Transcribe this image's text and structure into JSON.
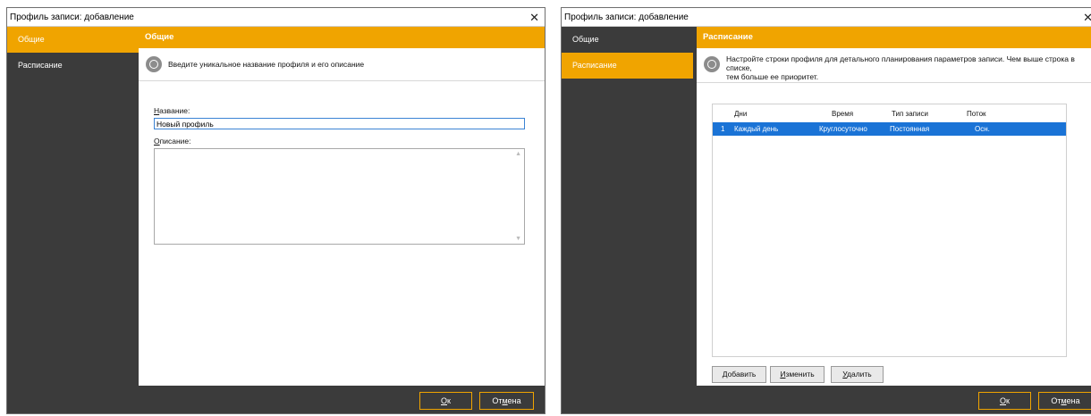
{
  "left_window": {
    "title": "Профиль записи: добавление",
    "sidebar": [
      {
        "label": "Общие",
        "active": true
      },
      {
        "label": "Расписание",
        "active": false
      }
    ],
    "header": "Общие",
    "info_text": "Введите уникальное название профиля и его описание",
    "name_label_ul": "Н",
    "name_label_rest": "азвание:",
    "name_value": "Новый профиль",
    "desc_label_ul": "О",
    "desc_label_rest": "писание:",
    "ok_ul": "О",
    "ok_rest": "к",
    "cancel_pre": "От",
    "cancel_ul": "м",
    "cancel_rest": "ена"
  },
  "right_window": {
    "title": "Профиль записи: добавление",
    "sidebar": [
      {
        "label": "Общие",
        "active": false
      },
      {
        "label": "Расписание",
        "active": true
      }
    ],
    "header": "Расписание",
    "info_line1": "Настройте строки профиля для детального планирования параметров записи. Чем выше строка в списке,",
    "info_line2": "тем больше ее приоритет.",
    "columns": [
      "Дни",
      "Время",
      "Тип записи",
      "Поток"
    ],
    "rows": [
      {
        "num": "1",
        "days": "Каждый день",
        "time": "Круглосуточно",
        "type": "Постоянная",
        "stream": "Осн."
      }
    ],
    "add_ul": "Д",
    "add_rest": "обавить",
    "edit_ul": "И",
    "edit_rest": "зменить",
    "delete_ul": "У",
    "delete_rest": "далить",
    "ok_ul": "О",
    "ok_rest": "к",
    "cancel_pre": "От",
    "cancel_ul": "м",
    "cancel_rest": "ена"
  },
  "colors": {
    "accent": "#f0a400",
    "sidebar": "#3b3b3b",
    "selection": "#1a73d6"
  }
}
